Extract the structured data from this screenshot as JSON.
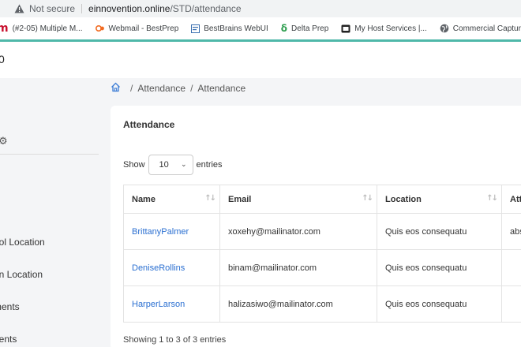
{
  "browser": {
    "security_label": "Not secure",
    "url_host": "einnovention.online",
    "url_path": "/STD/attendance"
  },
  "bookmarks": [
    {
      "icon": "m-logo-icon",
      "color": "#c8102e",
      "label": "(#2-05) Multiple M..."
    },
    {
      "icon": "webmail-icon",
      "color": "#f26b21",
      "label": "Webmail - BestPrep"
    },
    {
      "icon": "bestbrains-icon",
      "color": "#3a6fb0",
      "label": "BestBrains WebUI"
    },
    {
      "icon": "delta-icon",
      "color": "#2e9e4f",
      "label": "Delta Prep"
    },
    {
      "icon": "host-icon",
      "color": "#222222",
      "label": "My Host Services |..."
    },
    {
      "icon": "globe-icon",
      "color": "#555555",
      "label": "Commercial Captur..."
    }
  ],
  "app": {
    "logo_fragment": "0"
  },
  "sidebar": {
    "items": [
      {
        "label": "f"
      },
      {
        "label": "ool Location"
      },
      {
        "label": "gn Location"
      },
      {
        "label": "ments"
      },
      {
        "label": "dents"
      }
    ]
  },
  "breadcrumb": {
    "items": [
      "Attendance",
      "Attendance"
    ]
  },
  "card": {
    "title": "Attendance",
    "show_label": "Show",
    "entries_value": "10",
    "entries_label": "entries",
    "columns": [
      "Name",
      "Email",
      "Location",
      "Att"
    ],
    "rows": [
      {
        "name": "BrittanyPalmer",
        "email": "xoxehy@mailinator.com",
        "location": "Quis eos consequatu",
        "attendance": "abs"
      },
      {
        "name": "DeniseRollins",
        "email": "binam@mailinator.com",
        "location": "Quis eos consequatu",
        "attendance": ""
      },
      {
        "name": "HarperLarson",
        "email": "halizasiwo@mailinator.com",
        "location": "Quis eos consequatu",
        "attendance": ""
      }
    ],
    "footer": "Showing 1 to 3 of 3 entries"
  }
}
